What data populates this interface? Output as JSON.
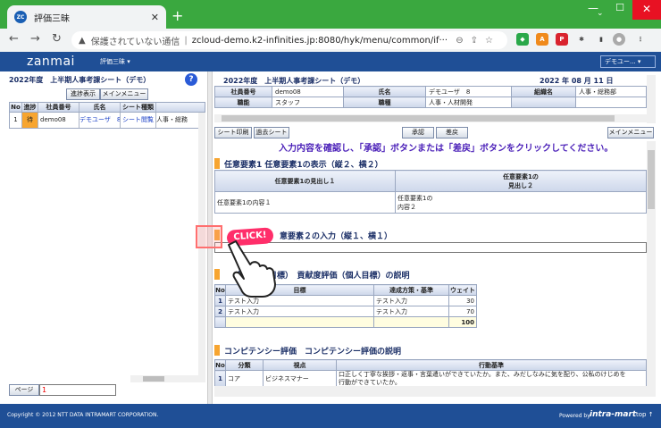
{
  "browser": {
    "tab_title": "評価三昧",
    "tab_favicon": "ZC",
    "new_tab": "+",
    "window_min": "—",
    "window_max": "☐",
    "window_close": "✕",
    "insecure_label": "保護されていない通信",
    "url": "zcloud-demo.k2-infinities.jp:8080/hyk/menu/common/if···"
  },
  "header": {
    "logo": "zanmai",
    "menu_label": "評価三昧 ▾",
    "user_menu": "デモユー... ▾"
  },
  "left": {
    "title": "2022年度　上半期人事考課シート（デモ）",
    "help": "?",
    "btn_progress": "進捗表示",
    "btn_main_menu": "メインメニュー",
    "columns": [
      "No",
      "進捗",
      "社員番号",
      "氏名",
      "シート種類",
      ""
    ],
    "rows": [
      {
        "no": "1",
        "status": "待",
        "emp_no": "demo08",
        "name": "デモユーザ　8",
        "sheet": "シート閲覧",
        "dept": "人事・総務"
      }
    ],
    "page_label": "ページ",
    "page_value": "1"
  },
  "right": {
    "title": "2022年度　上半期人事考課シート（デモ）",
    "date": "2022 年 08 月 11 日",
    "info": {
      "emp_no_label": "社員番号",
      "emp_no": "demo08",
      "name_label": "氏名",
      "name": "デモユーザ　8",
      "org_label": "組織名",
      "org": "人事・総務部",
      "title_label": "職能",
      "title": "スタッフ",
      "job_label": "職種",
      "job": "人事・人材開発"
    },
    "btn_print": "シート印刷",
    "btn_history": "過去シート",
    "btn_approve": "承認",
    "btn_reject": "差戻",
    "btn_main_menu": "メインメニュー",
    "confirm_msg": "入力内容を確認し、「承認」ボタンまたは「差戻」ボタンをクリックしてください。",
    "sec1_title": "任意要素1  任意要素1の表示（縦２、横２）",
    "sec1_h1": "任意要素1の見出し１",
    "sec1_h2a": "任意要素1の",
    "sec1_h2b": "見出し２",
    "sec1_c1": "任意要素1の内容１",
    "sec1_c2a": "任意要素1の",
    "sec1_c2b": "内容２",
    "sec2_title": "意要素２の入力（縦１、横１）",
    "sec3_title": "価（個人目標）　貢献度評価（個人目標）の説明",
    "goal_cols": [
      "No",
      "目標",
      "達成方策・基準",
      "ウェイト"
    ],
    "goal_rows": [
      {
        "no": "1",
        "goal": "テスト入力",
        "method": "テスト入力",
        "weight": "30"
      },
      {
        "no": "2",
        "goal": "テスト入力",
        "method": "テスト入力",
        "weight": "70"
      }
    ],
    "goal_total": "100",
    "sec4_title": "コンピテンシー評価　コンピテンシー評価の説明",
    "comp_cols": [
      "No",
      "分類",
      "視点",
      "行動基準"
    ],
    "comp_rows": [
      {
        "no": "1",
        "cat": "コア",
        "view": "ビジネスマナー",
        "line1": "口正しく丁寧な挨拶・返事・言葉遣いができていたか。また、みだしなみに気を配り、公私のけじめを",
        "line2": "行動ができていたか。"
      }
    ]
  },
  "overlay": {
    "click_label": "CLICK!"
  },
  "footer": {
    "copyright": "Copyright © 2012 NTT DATA INTRAMART CORPORATION.",
    "powered": "Powered by",
    "brand": "intra-mart",
    "top": "top ↑"
  }
}
